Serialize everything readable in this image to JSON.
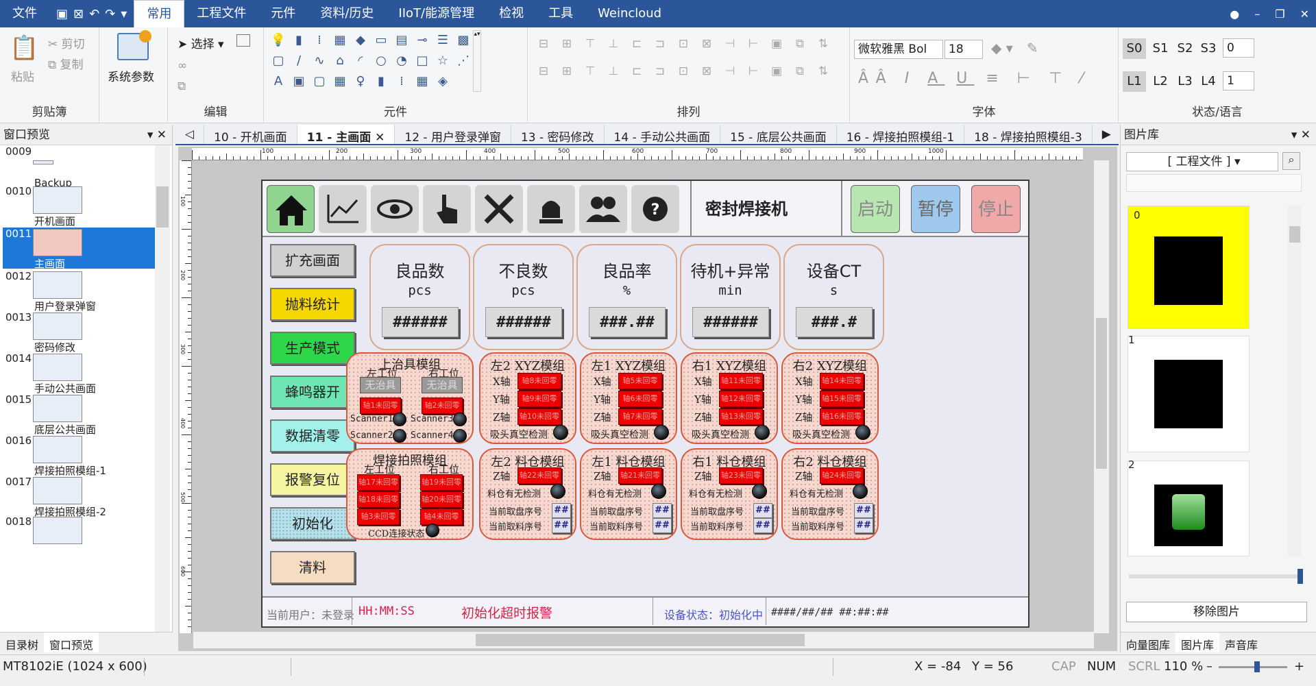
{
  "menubar": {
    "file": "文件",
    "tabs": [
      "常用",
      "工程文件",
      "元件",
      "资料/历史",
      "IIoT/能源管理",
      "检视",
      "工具",
      "Weincloud"
    ],
    "active": "常用"
  },
  "ribbon": {
    "clipboard": {
      "paste": "粘贴",
      "cut": "剪切",
      "copy": "复制",
      "label": "剪贴簿"
    },
    "system_params": "系统参数",
    "edit": {
      "select": "选择",
      "label": "编辑"
    },
    "components_label": "元件",
    "arrange_label": "排列",
    "font": {
      "name": "微软雅黑 Bol",
      "size": "18",
      "label": "字体"
    },
    "state": {
      "s_buttons": [
        "S0",
        "S1",
        "S2",
        "S3"
      ],
      "s_value": "0",
      "l_buttons": [
        "L1",
        "L2",
        "L3",
        "L4"
      ],
      "l_value": "1",
      "label": "状态/语言"
    }
  },
  "left_panel": {
    "title": "窗口预览",
    "items": [
      {
        "id": "0009",
        "name": ""
      },
      {
        "id": "",
        "name": "Backup"
      },
      {
        "id": "0010",
        "name": "开机画面"
      },
      {
        "id": "0011",
        "name": "主画面"
      },
      {
        "id": "0012",
        "name": "用户登录弹窗"
      },
      {
        "id": "0013",
        "name": "密码修改"
      },
      {
        "id": "0014",
        "name": "手动公共画面"
      },
      {
        "id": "0015",
        "name": "底层公共画面"
      },
      {
        "id": "0016",
        "name": "焊接拍照模组-1"
      },
      {
        "id": "0017",
        "name": "焊接拍照模组-2"
      },
      {
        "id": "0018",
        "name": ""
      }
    ],
    "tabs": [
      "目录树",
      "窗口预览"
    ]
  },
  "doc_tabs": [
    "10 - 开机画面",
    "11 - 主画面",
    "12 - 用户登录弹窗",
    "13 - 密码修改",
    "14 - 手动公共画面",
    "15 - 底层公共画面",
    "16 - 焊接拍照模组-1",
    "18 - 焊接拍照模组-3"
  ],
  "ruler_labels": [
    "100",
    "200",
    "300",
    "400",
    "500",
    "600",
    "700",
    "800",
    "900",
    "1000"
  ],
  "ruler_v_labels": [
    "100",
    "200",
    "300",
    "400",
    "500",
    "600"
  ],
  "screen": {
    "title": "密封焊接机",
    "top_buttons": {
      "start": "启动",
      "pause": "暂停",
      "stop": "停止"
    },
    "side_buttons": [
      "扩充画面",
      "抛料统计",
      "生产模式",
      "蜂鸣器开",
      "数据清零",
      "报警复位",
      "初始化",
      "清料"
    ],
    "kpis": [
      {
        "title": "良品数",
        "unit": "pcs",
        "value": "######"
      },
      {
        "title": "不良数",
        "unit": "pcs",
        "value": "######"
      },
      {
        "title": "良品率",
        "unit": "%",
        "value": "###.##"
      },
      {
        "title": "待机+异常",
        "unit": "min",
        "value": "######"
      },
      {
        "title": "设备CT",
        "unit": "s",
        "value": "###.#"
      }
    ],
    "upper_fixture": {
      "title": "上治具模组",
      "left": "左工位",
      "right": "右工位",
      "no_fixture": "无治具",
      "left_home": "轴1未回零",
      "right_home": "轴2未回零",
      "scanners": [
        "Scanner1",
        "Scanner2",
        "Scanner3",
        "Scanner4"
      ]
    },
    "xyz_modules": [
      {
        "title": "左2 XYZ模组",
        "x": "轴8未回零",
        "y": "轴9未回零",
        "z": "轴10未回零"
      },
      {
        "title": "左1 XYZ模组",
        "x": "轴5未回零",
        "y": "轴6未回零",
        "z": "轴7未回零"
      },
      {
        "title": "右1 XYZ模组",
        "x": "轴11未回零",
        "y": "轴12未回零",
        "z": "轴13未回零"
      },
      {
        "title": "右2 XYZ模组",
        "x": "轴14未回零",
        "y": "轴15未回零",
        "z": "轴16未回零"
      }
    ],
    "axis_labels": {
      "x": "X轴",
      "y": "Y轴",
      "z": "Z轴"
    },
    "vacuum": "吸头真空检测",
    "weld_camera": {
      "title": "焊接拍照模组",
      "left": "左工位",
      "right": "右工位",
      "left_axes": [
        "轴17未回零",
        "轴18未回零",
        "轴3未回零"
      ],
      "right_axes": [
        "轴19未回零",
        "轴20未回零",
        "轴4未回零"
      ],
      "ccd": "CCD连接状态"
    },
    "bins": [
      {
        "title": "左2 料仓模组",
        "z": "轴22未回零"
      },
      {
        "title": "左1 料仓模组",
        "z": "轴21未回零"
      },
      {
        "title": "右1 料仓模组",
        "z": "轴23未回零"
      },
      {
        "title": "右2 料仓模组",
        "z": "轴24未回零"
      }
    ],
    "bin_labels": {
      "presence": "料仓有无检测",
      "tray": "当前取盘序号",
      "material": "当前取料序号",
      "num": "##"
    },
    "status": {
      "user": "当前用户：未登录",
      "time": "HH:MM:SS",
      "alarm": "初始化超时报警",
      "device": "设备状态：初始化中",
      "datetime": "####/##/## ##:##:##"
    }
  },
  "right_panel": {
    "title": "图片库",
    "source": "[ 工程文件 ]",
    "images": [
      "0",
      "1",
      "2"
    ],
    "remove": "移除图片",
    "tabs": [
      "向量图库",
      "图片库",
      "声音库"
    ]
  },
  "statusbar": {
    "model": "MT8102iE (1024 x 600)",
    "x": "X = -84",
    "y": "Y = 56",
    "cap": "CAP",
    "num": "NUM",
    "scrl": "SCRL",
    "zoom": "110 %"
  },
  "colors": {
    "accent": "#2b579a",
    "module_border": "#d9593d",
    "alarm_red": "#ee0000"
  }
}
